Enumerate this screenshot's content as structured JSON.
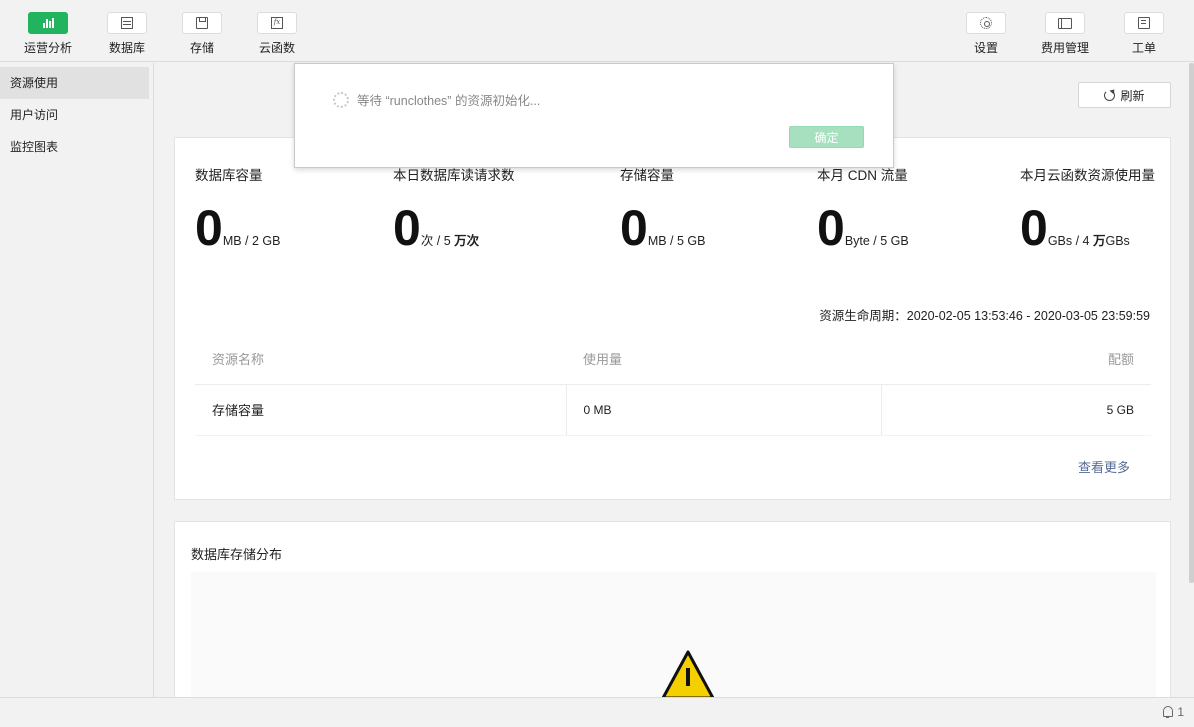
{
  "toolbar": {
    "left": [
      {
        "label": "运营分析",
        "icon": "bar-chart-icon",
        "active": true
      },
      {
        "label": "数据库",
        "icon": "database-icon"
      },
      {
        "label": "存储",
        "icon": "storage-icon"
      },
      {
        "label": "云函数",
        "icon": "function-icon"
      }
    ],
    "right": [
      {
        "label": "设置",
        "icon": "gear-icon"
      },
      {
        "label": "费用管理",
        "icon": "billing-icon"
      },
      {
        "label": "工单",
        "icon": "ticket-icon"
      }
    ]
  },
  "sidebar": {
    "items": [
      {
        "label": "资源使用",
        "active": true
      },
      {
        "label": "用户访问"
      },
      {
        "label": "监控图表"
      }
    ]
  },
  "main": {
    "refresh_label": "刷新",
    "stats": [
      {
        "title": "数据库容量",
        "value": "0",
        "unit": "MB / 2 GB"
      },
      {
        "title": "本日数据库读请求数",
        "value": "0",
        "unit_a": "次 / 5 ",
        "unit_b": "万次"
      },
      {
        "title": "存储容量",
        "value": "0",
        "unit": "MB / 5 GB"
      },
      {
        "title": "本月 CDN 流量",
        "value": "0",
        "unit": "Byte / 5 GB"
      },
      {
        "title": "本月云函数资源使用量",
        "value": "0",
        "unit_a": "GBs / 4 ",
        "unit_b": "万",
        "unit_c": "GBs"
      }
    ],
    "lifecycle_label": "资源生命周期：",
    "lifecycle_value": "2020-02-05 13:53:46 - 2020-03-05 23:59:59",
    "table": {
      "headers": [
        "资源名称",
        "使用量",
        "配额"
      ],
      "rows": [
        [
          "存储容量",
          "0 MB",
          "5 GB"
        ]
      ]
    },
    "more_label": "查看更多",
    "db_chart_title": "数据库存储分布"
  },
  "modal": {
    "message": "等待 “runclothes” 的资源初始化...",
    "ok_label": "确定"
  },
  "statusbar": {
    "notification_count": "1"
  },
  "colors": {
    "accent": "#22b35e",
    "link": "#576b95",
    "warning": "#f5d000"
  }
}
